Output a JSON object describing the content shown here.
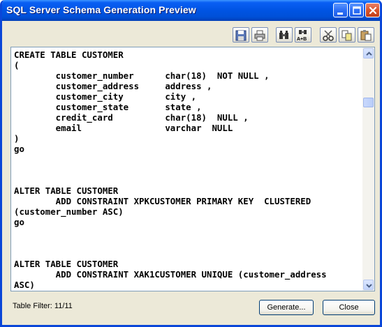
{
  "window": {
    "title": "SQL Server Schema Generation Preview"
  },
  "titlebar_buttons": [
    "minimize-icon",
    "maximize-icon",
    "close-icon"
  ],
  "toolbar": {
    "buttons": [
      {
        "name": "save-icon"
      },
      {
        "name": "print-icon"
      },
      {
        "name": "find-icon"
      },
      {
        "name": "replace-icon",
        "glyph": "A+B"
      },
      {
        "name": "cut-icon"
      },
      {
        "name": "copy-icon"
      },
      {
        "name": "paste-icon"
      }
    ]
  },
  "preview": {
    "lines": [
      "CREATE TABLE CUSTOMER",
      "(",
      "        customer_number      char(18)  NOT NULL ,",
      "        customer_address     address ,",
      "        customer_city        city ,",
      "        customer_state       state ,",
      "        credit_card          char(18)  NULL ,",
      "        email                varchar  NULL",
      ")",
      "go",
      "",
      "",
      "",
      "ALTER TABLE CUSTOMER",
      "        ADD CONSTRAINT XPKCUSTOMER PRIMARY KEY  CLUSTERED",
      "(customer_number ASC)",
      "go",
      "",
      "",
      "",
      "ALTER TABLE CUSTOMER",
      "        ADD CONSTRAINT XAK1CUSTOMER UNIQUE (customer_address",
      "ASC)"
    ]
  },
  "footer": {
    "table_filter": "Table Filter: 11/11",
    "generate_label": "Generate...",
    "close_label": "Close"
  },
  "colors": {
    "titlebar": "#0054e3",
    "window_bg": "#ece9d8",
    "border": "#0a46d8"
  }
}
